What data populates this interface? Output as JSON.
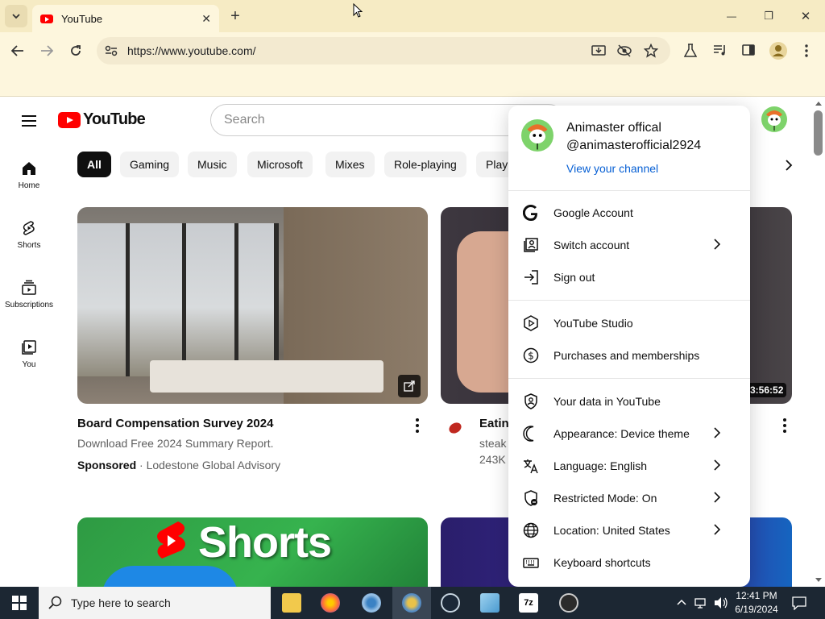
{
  "browser": {
    "tab_title": "YouTube",
    "tab_close": "✕",
    "new_tab": "+",
    "url": "https://www.youtube.com/",
    "window_controls": {
      "minimize": "—",
      "maximize": "❐",
      "close": "✕"
    }
  },
  "youtube": {
    "logo_text": "YouTube",
    "search_placeholder": "Search",
    "chips": [
      "All",
      "Gaming",
      "Music",
      "Microsoft",
      "Mixes",
      "Role-playing",
      "Playl"
    ],
    "sidebar": [
      {
        "label": "Home",
        "icon": "home-icon"
      },
      {
        "label": "Shorts",
        "icon": "shorts-icon"
      },
      {
        "label": "Subscriptions",
        "icon": "subscriptions-icon"
      },
      {
        "label": "You",
        "icon": "you-icon"
      }
    ],
    "videos": [
      {
        "title": "Board Compensation Survey 2024",
        "line1": "Download Free 2024 Summary Report.",
        "sponsored": "Sponsored",
        "advertiser": "Lodestone Global Advisory"
      },
      {
        "title": "Eatin",
        "line1": "steak",
        "line2": "243K",
        "duration": "3:56:52"
      }
    ],
    "shorts_label": "Shorts"
  },
  "account_menu": {
    "name": "Animaster offical",
    "handle": "@animasterofficial2924",
    "view_channel": "View your channel",
    "items": [
      {
        "label": "Google Account",
        "icon": "google-g-icon",
        "chevron": false
      },
      {
        "label": "Switch account",
        "icon": "switch-account-icon",
        "chevron": true
      },
      {
        "label": "Sign out",
        "icon": "sign-out-icon",
        "chevron": false
      },
      {
        "label": "YouTube Studio",
        "icon": "youtube-studio-icon",
        "chevron": false
      },
      {
        "label": "Purchases and memberships",
        "icon": "dollar-icon",
        "chevron": false
      },
      {
        "label": "Your data in YouTube",
        "icon": "shield-person-icon",
        "chevron": false
      },
      {
        "label": "Appearance: Device theme",
        "icon": "moon-icon",
        "chevron": true
      },
      {
        "label": "Language: English",
        "icon": "translate-icon",
        "chevron": true
      },
      {
        "label": "Restricted Mode: On",
        "icon": "restricted-icon",
        "chevron": true
      },
      {
        "label": "Location: United States",
        "icon": "globe-icon",
        "chevron": true
      },
      {
        "label": "Keyboard shortcuts",
        "icon": "keyboard-icon",
        "chevron": false
      }
    ]
  },
  "taskbar": {
    "search_placeholder": "Type here to search",
    "time": "12:41 PM",
    "date": "6/19/2024"
  },
  "colors": {
    "youtube_red": "#ff0000",
    "link_blue": "#065fd4",
    "chrome_bg": "#f6ebc4",
    "taskbar": "#1c2733"
  }
}
